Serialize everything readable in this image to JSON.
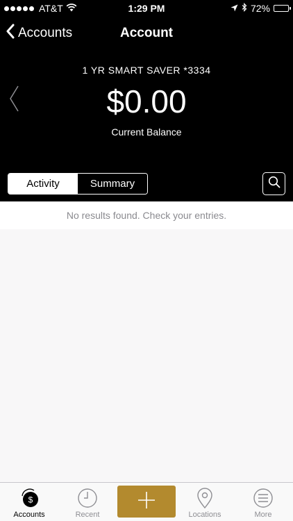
{
  "status_bar": {
    "carrier": "AT&T",
    "time": "1:29 PM",
    "battery_text": "72%",
    "battery_level": 0.72
  },
  "nav": {
    "back_label": "Accounts",
    "title": "Account"
  },
  "account": {
    "name": "1 YR SMART SAVER *3334",
    "balance": "$0.00",
    "balance_label": "Current Balance"
  },
  "segments": [
    {
      "label": "Activity",
      "active": true
    },
    {
      "label": "Summary",
      "active": false
    }
  ],
  "empty_message": "No results found. Check your entries.",
  "tabs": [
    {
      "label": "Accounts",
      "icon": "accounts-dollar-icon",
      "active": true
    },
    {
      "label": "Recent",
      "icon": "clock-icon",
      "active": false
    },
    {
      "label": "",
      "icon": "plus-icon",
      "active": false
    },
    {
      "label": "Locations",
      "icon": "location-pin-icon",
      "active": false
    },
    {
      "label": "More",
      "icon": "menu-icon",
      "active": false
    }
  ],
  "colors": {
    "header_bg": "#000000",
    "accent_gold": "#b38a2e",
    "muted_text": "#8a8a8f"
  },
  "icons": {
    "back": "chevron-left-icon",
    "prev_account": "chevron-left-thin-icon",
    "search": "search-icon",
    "wifi": "wifi-icon",
    "location": "location-arrow-icon",
    "bluetooth": "bluetooth-icon",
    "battery": "battery-icon"
  }
}
